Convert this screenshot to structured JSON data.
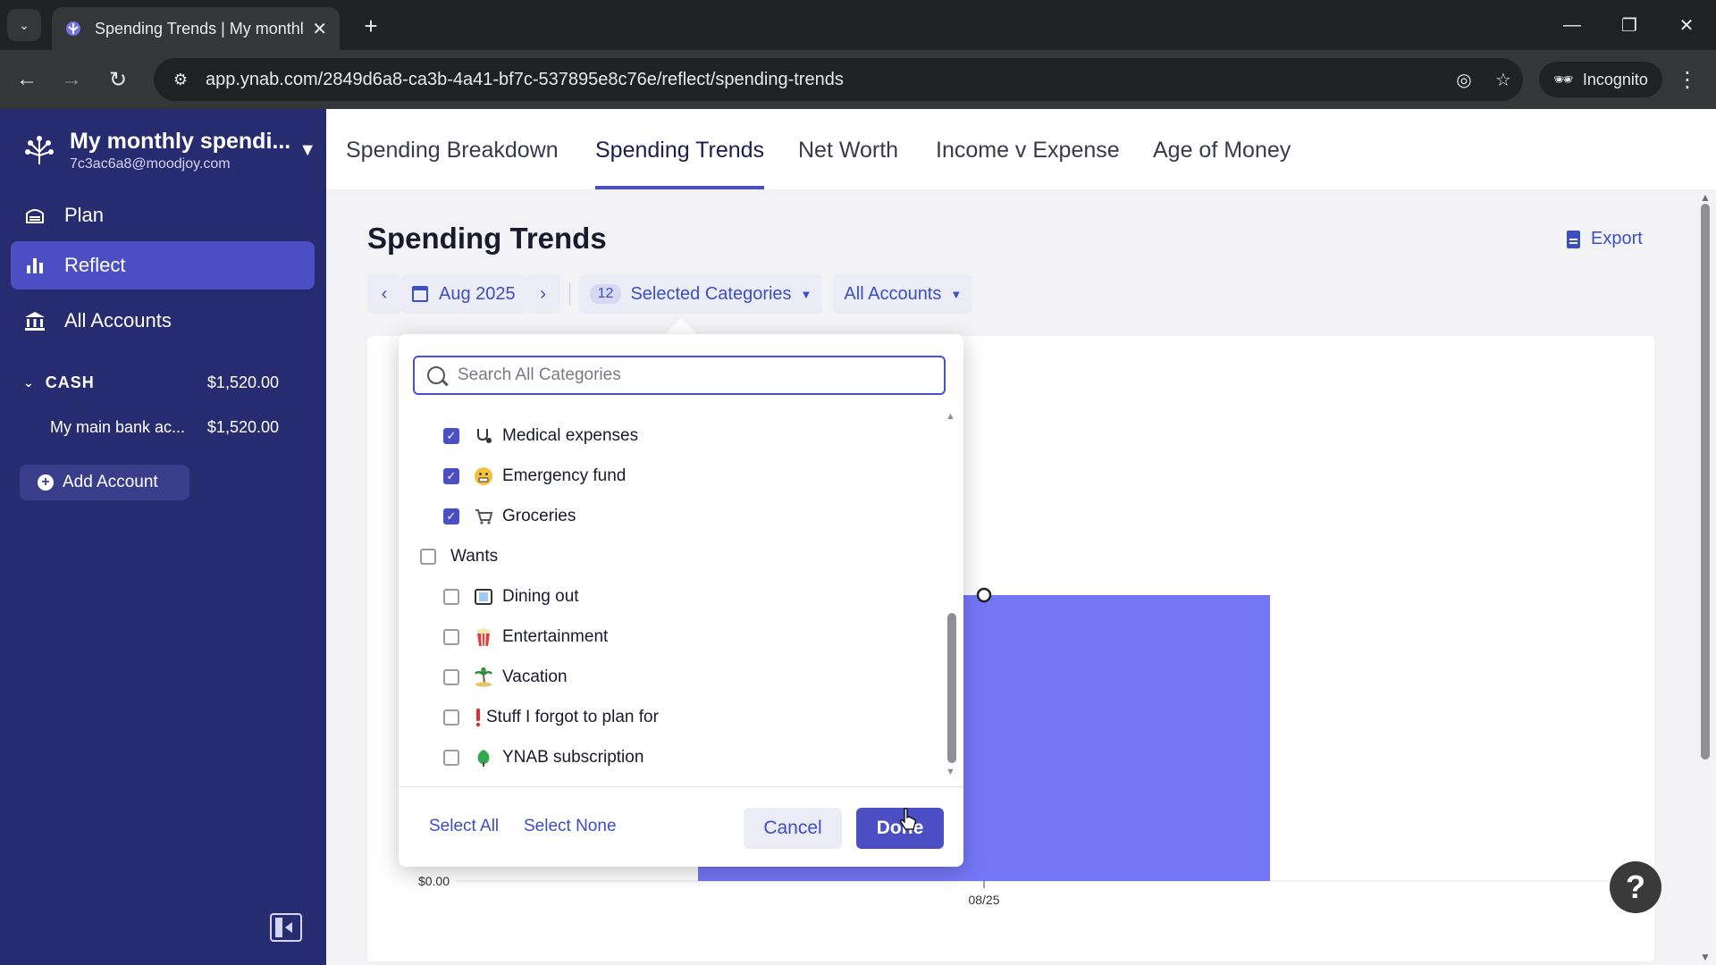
{
  "browser": {
    "tab_title": "Spending Trends | My monthly",
    "url": "app.ynab.com/2849d6a8-ca3b-4a41-bf7c-537895e8c76e/reflect/spending-trends",
    "incognito_label": "Incognito"
  },
  "sidebar": {
    "budget_name": "My monthly spendi...",
    "budget_email": "7c3ac6a8@moodjoy.com",
    "nav": [
      {
        "label": "Plan",
        "icon": "plan-icon"
      },
      {
        "label": "Reflect",
        "icon": "reflect-icon"
      },
      {
        "label": "All Accounts",
        "icon": "bank-icon"
      }
    ],
    "account_group": {
      "name": "CASH",
      "balance": "$1,520.00"
    },
    "accounts": [
      {
        "name": "My main bank ac...",
        "balance": "$1,520.00"
      }
    ],
    "add_account_label": "Add Account"
  },
  "report_tabs": [
    "Spending Breakdown",
    "Spending Trends",
    "Net Worth",
    "Income v Expense",
    "Age of Money"
  ],
  "page": {
    "title": "Spending Trends",
    "export_label": "Export",
    "date_label": "Aug 2025",
    "category_count": "12",
    "categories_label": "Selected Categories",
    "accounts_label": "All Accounts"
  },
  "popover": {
    "search_placeholder": "Search All Categories",
    "items": [
      {
        "label": "Medical expenses",
        "icon": "stethoscope-icon",
        "checked": true,
        "level": 1
      },
      {
        "label": "Emergency fund",
        "icon": "grimace-emoji-icon",
        "checked": true,
        "level": 1
      },
      {
        "label": "Groceries",
        "icon": "shopping-cart-icon",
        "checked": true,
        "level": 1
      },
      {
        "label": "Wants",
        "icon": "",
        "checked": false,
        "level": 0
      },
      {
        "label": "Dining out",
        "icon": "film-frame-icon",
        "checked": false,
        "level": 1
      },
      {
        "label": "Entertainment",
        "icon": "popcorn-icon",
        "checked": false,
        "level": 1
      },
      {
        "label": "Vacation",
        "icon": "palm-island-icon",
        "checked": false,
        "level": 1
      },
      {
        "label": "Stuff I forgot to plan for",
        "icon": "exclamation-icon",
        "checked": false,
        "level": 1
      },
      {
        "label": "YNAB subscription",
        "icon": "green-tree-icon",
        "checked": false,
        "level": 1
      }
    ],
    "select_all_label": "Select All",
    "select_none_label": "Select None",
    "cancel_label": "Cancel",
    "done_label": "Done"
  },
  "colors": {
    "sidebar": "#272b70",
    "accent": "#4c4fc4",
    "bar": "#7477f5",
    "link": "#3b4ec2"
  },
  "chart_data": {
    "type": "bar",
    "categories": [
      "08/25"
    ],
    "values": [
      1
    ],
    "y_tick_labels": [
      "$0.00"
    ],
    "title": "",
    "xlabel": "",
    "ylabel": ""
  }
}
